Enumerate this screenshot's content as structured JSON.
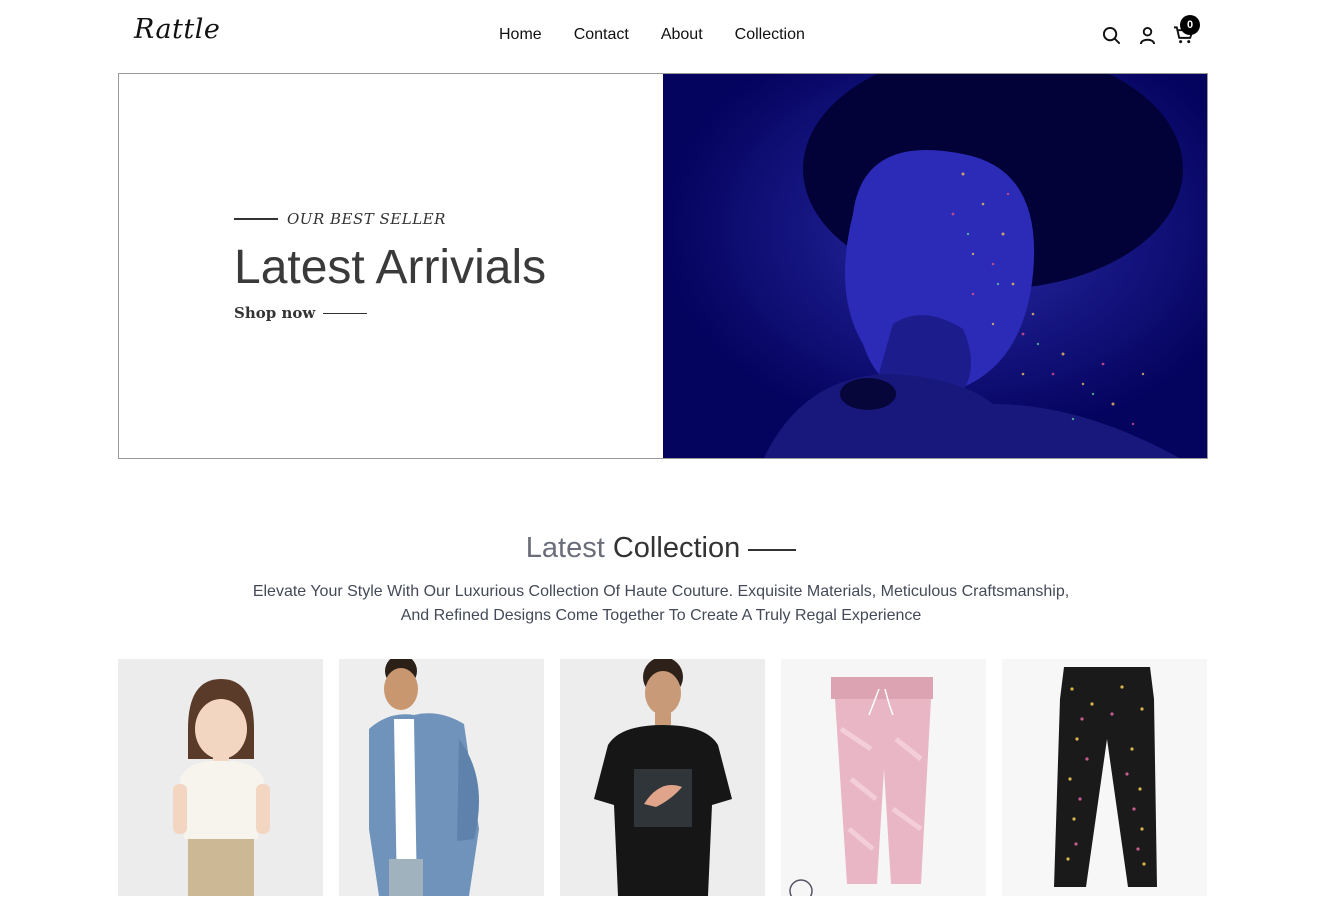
{
  "header": {
    "logo_text": "Rattle",
    "nav": [
      {
        "label": "Home"
      },
      {
        "label": "Contact"
      },
      {
        "label": "About"
      },
      {
        "label": "Collection"
      }
    ],
    "icons": [
      "search-icon",
      "user-icon",
      "cart-icon"
    ],
    "cart_count": "0"
  },
  "hero": {
    "eyebrow": "OUR BEST SELLER",
    "title": "Latest Arrivials",
    "cta": "Shop now",
    "image_bg": "#04035e"
  },
  "collection": {
    "title_light": "Latest",
    "title_dark": "Collection",
    "description_line1": "Elevate Your Style With Our Luxurious Collection Of Haute Couture. Exquisite Materials, Meticulous Craftsmanship,",
    "description_line2": "And Refined Designs Come Together To Create A Truly Regal Experience"
  },
  "products": [
    {
      "kind": "girl-white-top"
    },
    {
      "kind": "denim-jacket"
    },
    {
      "kind": "black-tshirt"
    },
    {
      "kind": "pink-joggers"
    },
    {
      "kind": "black-dotted-pants"
    }
  ],
  "colors": {
    "accent": "#000000",
    "hero_blue": "#04035e",
    "title_gray": "#6b6e7a"
  }
}
